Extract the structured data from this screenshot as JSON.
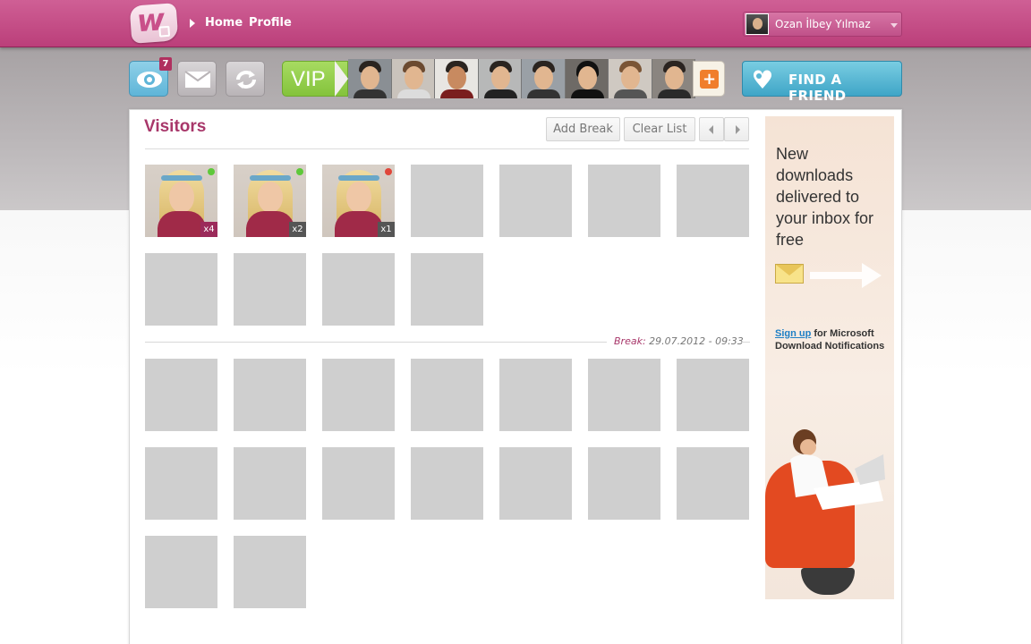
{
  "header": {
    "home_label": "Home",
    "profile_label": "Profile",
    "user_name": "Ozan İlbey Yılmaz"
  },
  "toolbar": {
    "visitors_badge": "7",
    "vip_label": "VIP",
    "plus_label": "+",
    "find_friend_label": "FIND A FRIEND"
  },
  "main": {
    "title": "Visitors",
    "add_break_label": "Add Break",
    "clear_list_label": "Clear List",
    "visitors": [
      {
        "status": "online",
        "count": "x4"
      },
      {
        "status": "online",
        "count": "x2"
      },
      {
        "status": "offline",
        "count": "x1"
      }
    ],
    "break_label": "Break:",
    "break_time": "29.07.2012 - 09:33"
  },
  "ad": {
    "headline": "New downloads delivered to your inbox for free",
    "signup_link": "Sign up",
    "signup_text": " for Microsoft Download Notifications"
  },
  "colors": {
    "brand": "#c24a86",
    "accent_blue": "#4aa9cc",
    "vip_green": "#8fca45",
    "online": "#5ec83a",
    "offline": "#e0463a"
  }
}
